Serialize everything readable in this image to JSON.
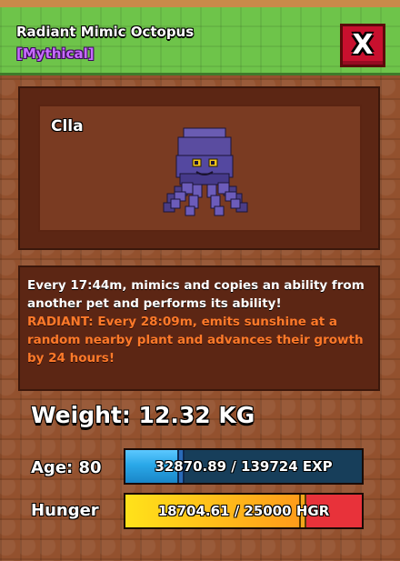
{
  "header": {
    "pet_name": "Radiant Mimic Octopus",
    "rarity": "[Mythical]",
    "close_label": "X"
  },
  "preview": {
    "nickname": "Clla",
    "model_icon": "octopus-pet-icon"
  },
  "description": {
    "ability": "Every 17:44m, mimics and copies an ability from another pet and performs its ability!",
    "mutation": "RADIANT: Every 28:09m, emits sunshine at a random nearby plant and advances their growth by 24 hours!"
  },
  "stats": {
    "weight": "Weight: 12.32 KG",
    "age_label": "Age: 80",
    "exp_text": "32870.89 / 139724 EXP",
    "exp_current": 32870.89,
    "exp_max": 139724,
    "hunger_label": "Hunger",
    "hunger_text": "18704.61 / 25000 HGR",
    "hunger_current": 18704.61,
    "hunger_max": 25000
  },
  "colors": {
    "header_green": "#6ec44a",
    "rarity_purple": "#c86bff",
    "close_red": "#c8102e",
    "mutation_orange": "#ff7a2a",
    "exp_blue": "#2aa8e8",
    "exp_track": "#173e5a",
    "hunger_yellow": "#ffd21a",
    "hunger_track": "#e8323a"
  }
}
